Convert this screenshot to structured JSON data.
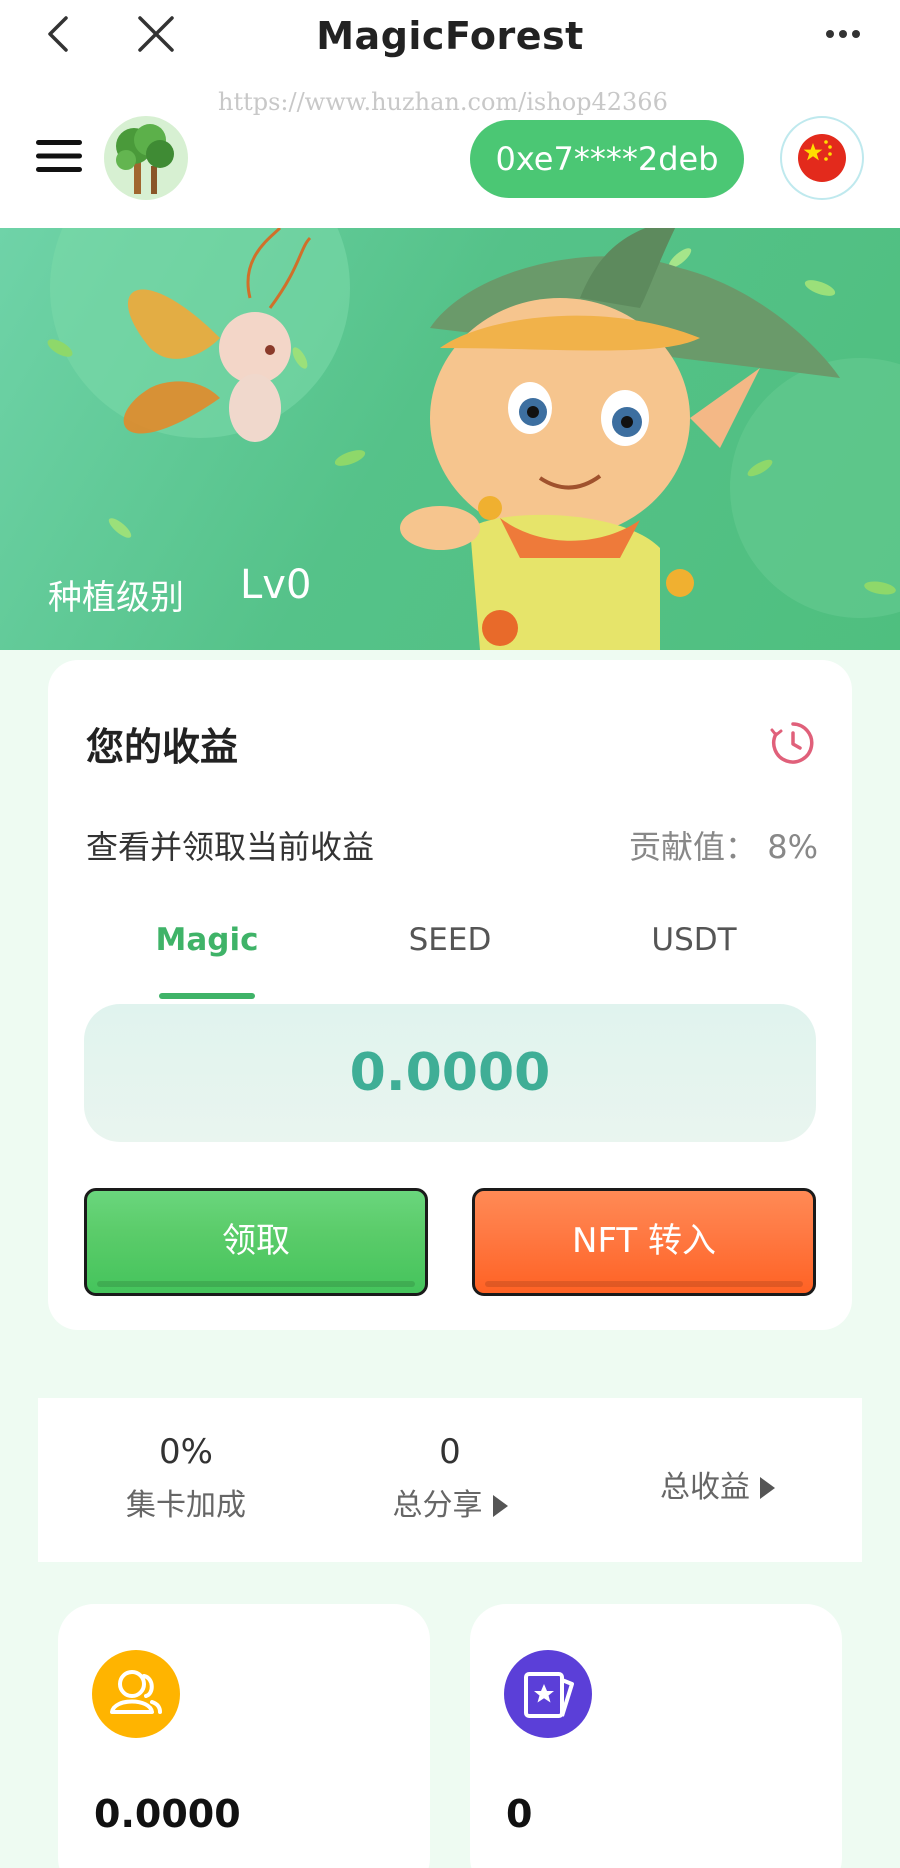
{
  "topbar": {
    "title": "MagicForest"
  },
  "header": {
    "watermark": "https://www.huzhan.com/ishop42366",
    "wallet_address": "0xe7****2deb"
  },
  "banner": {
    "level_label": "种植级别",
    "level_value": "Lv0"
  },
  "earnings": {
    "title": "您的收益",
    "subtitle": "查看并领取当前收益",
    "contribution": "贡献值： 8%",
    "tabs": [
      {
        "label": "Magic",
        "active": true
      },
      {
        "label": "SEED",
        "active": false
      },
      {
        "label": "USDT",
        "active": false
      }
    ],
    "amount": "0.0000",
    "claim_label": "领取",
    "nft_label": "NFT 转入"
  },
  "stats": {
    "card_bonus_value": "0%",
    "card_bonus_label": "集卡加成",
    "total_share_value": "0",
    "total_share_label": "总分享",
    "total_income_label": "总收益"
  },
  "mini_cards": [
    {
      "value": "0.0000",
      "icon": "user-icon",
      "color": "#ffb400"
    },
    {
      "value": "0",
      "icon": "card-icon",
      "color": "#5b3fd8"
    }
  ],
  "colors": {
    "primary_green": "#4bc774",
    "accent_orange": "#ff6a2c",
    "amount_teal": "#3fae96"
  }
}
